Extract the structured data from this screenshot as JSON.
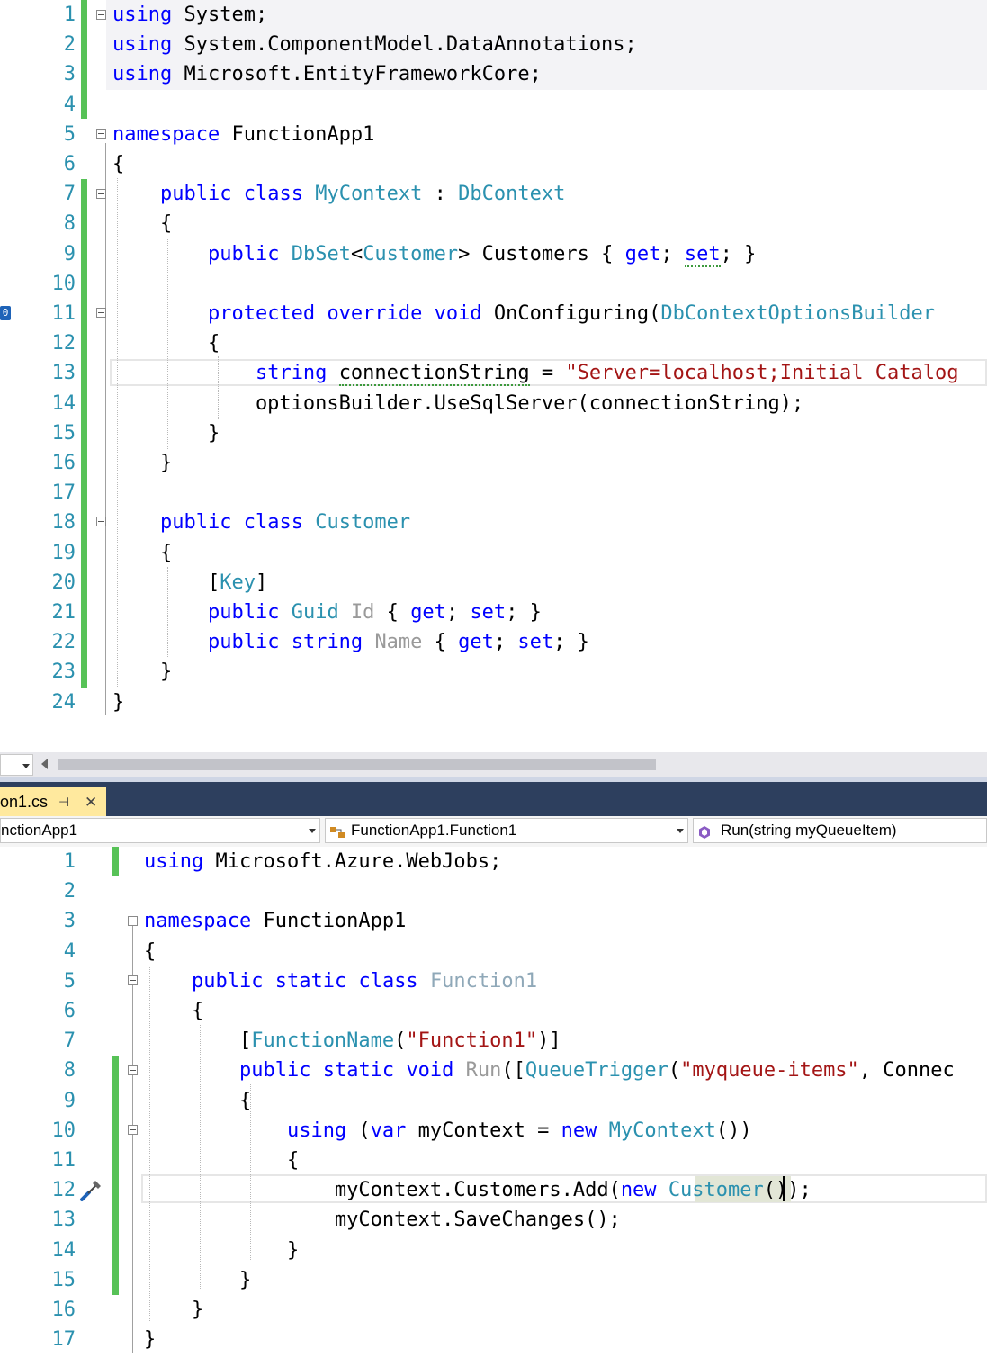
{
  "top_editor": {
    "lines": [
      {
        "n": "1",
        "segs": [
          [
            "using",
            "kw"
          ],
          [
            " System;",
            ""
          ]
        ]
      },
      {
        "n": "2",
        "segs": [
          [
            "using",
            "kw"
          ],
          [
            " System.ComponentModel.DataAnnotations;",
            ""
          ]
        ]
      },
      {
        "n": "3",
        "segs": [
          [
            "using",
            "kw"
          ],
          [
            " Microsoft.EntityFrameworkCore;",
            ""
          ]
        ]
      },
      {
        "n": "4",
        "segs": []
      },
      {
        "n": "5",
        "segs": [
          [
            "namespace",
            "kw"
          ],
          [
            " FunctionApp1",
            ""
          ]
        ]
      },
      {
        "n": "6",
        "segs": [
          [
            "{",
            ""
          ]
        ]
      },
      {
        "n": "7",
        "segs": [
          [
            "    ",
            ""
          ],
          [
            "public",
            "kw"
          ],
          [
            " ",
            ""
          ],
          [
            "class",
            "kw"
          ],
          [
            " ",
            ""
          ],
          [
            "MyContext",
            "ty"
          ],
          [
            " : ",
            ""
          ],
          [
            "DbContext",
            "ty"
          ]
        ]
      },
      {
        "n": "8",
        "segs": [
          [
            "    {",
            ""
          ]
        ]
      },
      {
        "n": "9",
        "segs": [
          [
            "        ",
            ""
          ],
          [
            "public",
            "kw"
          ],
          [
            " ",
            ""
          ],
          [
            "DbSet",
            "ty"
          ],
          [
            "<",
            ""
          ],
          [
            "Customer",
            "ty"
          ],
          [
            "> Customers { ",
            ""
          ],
          [
            "get",
            "kw"
          ],
          [
            "; ",
            ""
          ],
          [
            "set",
            "kw squig"
          ],
          [
            "; }",
            ""
          ]
        ]
      },
      {
        "n": "10",
        "segs": []
      },
      {
        "n": "11",
        "segs": [
          [
            "        ",
            ""
          ],
          [
            "protected",
            "kw"
          ],
          [
            " ",
            ""
          ],
          [
            "override",
            "kw"
          ],
          [
            " ",
            ""
          ],
          [
            "void",
            "kw"
          ],
          [
            " OnConfiguring(",
            ""
          ],
          [
            "DbContextOptionsBuilder",
            "ty"
          ]
        ]
      },
      {
        "n": "12",
        "segs": [
          [
            "        {",
            ""
          ]
        ]
      },
      {
        "n": "13",
        "segs": [
          [
            "            ",
            ""
          ],
          [
            "string",
            "kw"
          ],
          [
            " ",
            ""
          ],
          [
            "connectionString",
            "squig"
          ],
          [
            " = ",
            ""
          ],
          [
            "\"Server=localhost;Initial Catalog",
            "st"
          ]
        ]
      },
      {
        "n": "14",
        "segs": [
          [
            "            optionsBuilder.UseSqlServer(connectionString);",
            ""
          ]
        ]
      },
      {
        "n": "15",
        "segs": [
          [
            "        }",
            ""
          ]
        ]
      },
      {
        "n": "16",
        "segs": [
          [
            "    }",
            ""
          ]
        ]
      },
      {
        "n": "17",
        "segs": []
      },
      {
        "n": "18",
        "segs": [
          [
            "    ",
            ""
          ],
          [
            "public",
            "kw"
          ],
          [
            " ",
            ""
          ],
          [
            "class",
            "kw"
          ],
          [
            " ",
            ""
          ],
          [
            "Customer",
            "ty"
          ]
        ]
      },
      {
        "n": "19",
        "segs": [
          [
            "    {",
            ""
          ]
        ]
      },
      {
        "n": "20",
        "segs": [
          [
            "        [",
            ""
          ],
          [
            "Key",
            "ty"
          ],
          [
            "]",
            ""
          ]
        ]
      },
      {
        "n": "21",
        "segs": [
          [
            "        ",
            ""
          ],
          [
            "public",
            "kw"
          ],
          [
            " ",
            ""
          ],
          [
            "Guid",
            "ty"
          ],
          [
            " ",
            ""
          ],
          [
            "Id",
            "gr"
          ],
          [
            " { ",
            ""
          ],
          [
            "get",
            "kw"
          ],
          [
            "; ",
            ""
          ],
          [
            "set",
            "kw"
          ],
          [
            "; }",
            ""
          ]
        ]
      },
      {
        "n": "22",
        "segs": [
          [
            "        ",
            ""
          ],
          [
            "public",
            "kw"
          ],
          [
            " ",
            ""
          ],
          [
            "string",
            "kw"
          ],
          [
            " ",
            ""
          ],
          [
            "Name",
            "gr"
          ],
          [
            " { ",
            ""
          ],
          [
            "get",
            "kw"
          ],
          [
            "; ",
            ""
          ],
          [
            "set",
            "kw"
          ],
          [
            "; }",
            ""
          ]
        ]
      },
      {
        "n": "23",
        "segs": [
          [
            "    }",
            ""
          ]
        ]
      },
      {
        "n": "24",
        "segs": [
          [
            "}",
            ""
          ]
        ]
      }
    ]
  },
  "tab": {
    "label": "on1.cs",
    "pin": "⊣",
    "close": "✕"
  },
  "nav": {
    "project": "nctionApp1",
    "type": "FunctionApp1.Function1",
    "member": "Run(string myQueueItem)"
  },
  "bottom_editor": {
    "lines": [
      {
        "n": "1",
        "segs": [
          [
            "using",
            "kw"
          ],
          [
            " Microsoft.Azure.WebJobs;",
            ""
          ]
        ]
      },
      {
        "n": "2",
        "segs": []
      },
      {
        "n": "3",
        "segs": [
          [
            "namespace",
            "kw"
          ],
          [
            " FunctionApp1",
            ""
          ]
        ]
      },
      {
        "n": "4",
        "segs": [
          [
            "{",
            ""
          ]
        ]
      },
      {
        "n": "5",
        "segs": [
          [
            "    ",
            ""
          ],
          [
            "public",
            "kw"
          ],
          [
            " ",
            ""
          ],
          [
            "static",
            "kw"
          ],
          [
            " ",
            ""
          ],
          [
            "class",
            "kw"
          ],
          [
            " ",
            ""
          ],
          [
            "Function1",
            "gray2"
          ]
        ]
      },
      {
        "n": "6",
        "segs": [
          [
            "    {",
            ""
          ]
        ]
      },
      {
        "n": "7",
        "segs": [
          [
            "        [",
            ""
          ],
          [
            "FunctionName",
            "ty"
          ],
          [
            "(",
            ""
          ],
          [
            "\"Function1\"",
            "st"
          ],
          [
            ")]",
            ""
          ]
        ]
      },
      {
        "n": "8",
        "segs": [
          [
            "        ",
            ""
          ],
          [
            "public",
            "kw"
          ],
          [
            " ",
            ""
          ],
          [
            "static",
            "kw"
          ],
          [
            " ",
            ""
          ],
          [
            "void",
            "kw"
          ],
          [
            " ",
            ""
          ],
          [
            "Run",
            "gr"
          ],
          [
            "([",
            ""
          ],
          [
            "QueueTrigger",
            "ty"
          ],
          [
            "(",
            ""
          ],
          [
            "\"myqueue-items\"",
            "st"
          ],
          [
            ", Connec",
            ""
          ]
        ]
      },
      {
        "n": "9",
        "segs": [
          [
            "        {",
            ""
          ]
        ]
      },
      {
        "n": "10",
        "segs": [
          [
            "            ",
            ""
          ],
          [
            "using",
            "kw"
          ],
          [
            " (",
            ""
          ],
          [
            "var",
            "kw"
          ],
          [
            " myContext = ",
            ""
          ],
          [
            "new",
            "kw"
          ],
          [
            " ",
            ""
          ],
          [
            "MyContext",
            "ty"
          ],
          [
            "())",
            ""
          ]
        ]
      },
      {
        "n": "11",
        "segs": [
          [
            "            {",
            ""
          ]
        ]
      },
      {
        "n": "12",
        "segs": [
          [
            "                myContext.Customers.Add(",
            ""
          ],
          [
            "new",
            "kw"
          ],
          [
            " ",
            ""
          ],
          [
            "Customer",
            "ty"
          ],
          [
            "());",
            ""
          ]
        ]
      },
      {
        "n": "13",
        "segs": [
          [
            "                myContext.SaveChanges();",
            ""
          ]
        ]
      },
      {
        "n": "14",
        "segs": [
          [
            "            }",
            ""
          ]
        ]
      },
      {
        "n": "15",
        "segs": [
          [
            "        }",
            ""
          ]
        ]
      },
      {
        "n": "16",
        "segs": [
          [
            "    }",
            ""
          ]
        ]
      },
      {
        "n": "17",
        "segs": [
          [
            "}",
            ""
          ]
        ]
      }
    ]
  },
  "icons": {
    "bookmark_icon": "0",
    "nav_type_icon": "class-icon",
    "nav_member_icon": "method-icon",
    "quick_action_icon": "screwdriver-brush-icon"
  }
}
